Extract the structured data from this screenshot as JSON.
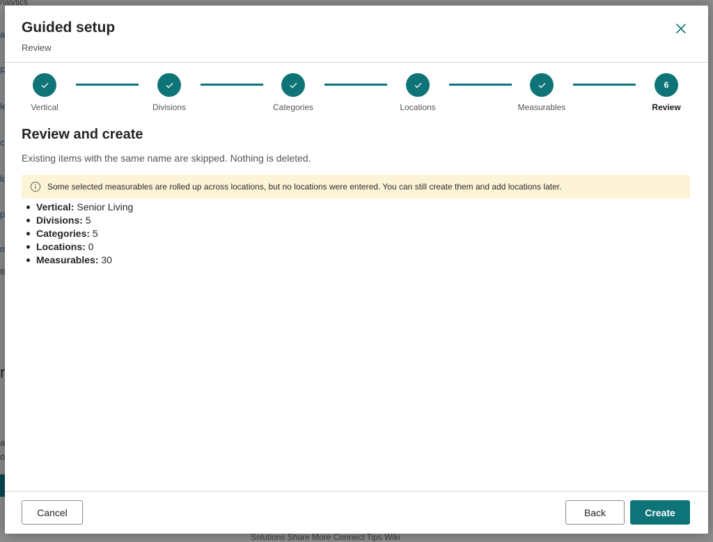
{
  "background": {
    "fragments": [
      "nalytics",
      "a",
      "R",
      "le",
      "ca",
      "ld",
      "p",
      "m",
      "re",
      "a",
      "o",
      "e"
    ],
    "footer_text": "Solutions  Share  More  Connect  Tips  Wiki"
  },
  "dialog": {
    "title": "Guided setup",
    "subtitle": "Review",
    "close_icon": "close-icon"
  },
  "stepper": {
    "steps": [
      {
        "label": "Vertical",
        "state": "complete",
        "marker": "✓"
      },
      {
        "label": "Divisions",
        "state": "complete",
        "marker": "✓"
      },
      {
        "label": "Categories",
        "state": "complete",
        "marker": "✓"
      },
      {
        "label": "Locations",
        "state": "complete",
        "marker": "✓"
      },
      {
        "label": "Measurables",
        "state": "complete",
        "marker": "✓"
      },
      {
        "label": "Review",
        "state": "current",
        "marker": "6"
      }
    ]
  },
  "review": {
    "title": "Review and create",
    "description": "Existing items with the same name are skipped. Nothing is deleted.",
    "warning": "Some selected measurables are rolled up across locations, but no locations were entered. You can still create them and add locations later.",
    "summary": [
      {
        "label": "Vertical:",
        "value": "Senior Living"
      },
      {
        "label": "Divisions:",
        "value": "5"
      },
      {
        "label": "Categories:",
        "value": "5"
      },
      {
        "label": "Locations:",
        "value": "0"
      },
      {
        "label": "Measurables:",
        "value": "30"
      }
    ]
  },
  "footer": {
    "cancel_label": "Cancel",
    "back_label": "Back",
    "create_label": "Create"
  },
  "colors": {
    "accent": "#0e7478",
    "warning_bg": "#fdf3d6"
  }
}
